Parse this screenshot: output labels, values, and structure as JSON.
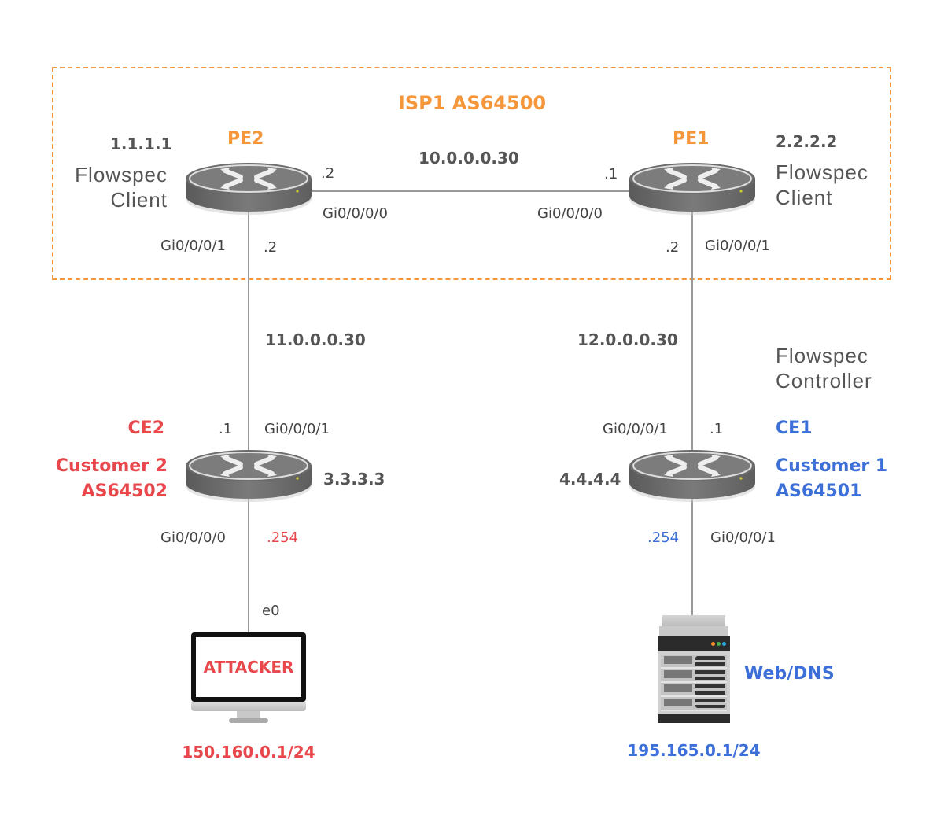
{
  "isp": {
    "title": "ISP1 AS64500"
  },
  "pe2": {
    "name": "PE2",
    "loopback": "1.1.1.1",
    "role_line1": "Flowspec",
    "role_line2": "Client",
    "east_ip": ".2",
    "east_if": "Gi0/0/0/0",
    "south_if": "Gi0/0/0/1",
    "south_ip": ".2"
  },
  "pe1": {
    "name": "PE1",
    "loopback": "2.2.2.2",
    "role_line1": "Flowspec",
    "role_line2": "Client",
    "west_ip": ".1",
    "west_if": "Gi0/0/0/0",
    "south_if": "Gi0/0/0/1",
    "south_ip": ".2"
  },
  "links": {
    "pe_pe": "10.0.0.0.30",
    "pe2_ce2": "11.0.0.0.30",
    "pe1_ce1": "12.0.0.0.30"
  },
  "ce2": {
    "name": "CE2",
    "customer": "Customer 2",
    "asn": "AS64502",
    "loopback": "3.3.3.3",
    "north_ip": ".1",
    "north_if": "Gi0/0/0/1",
    "south_if": "Gi0/0/0/0",
    "south_ip": ".254"
  },
  "ce1": {
    "name": "CE1",
    "customer": "Customer 1",
    "asn": "AS64501",
    "loopback": "4.4.4.4",
    "north_if": "Gi0/0/0/1",
    "north_ip": ".1",
    "south_ip": ".254",
    "south_if": "Gi0/0/0/1",
    "role_line1": "Flowspec",
    "role_line2": "Controller"
  },
  "attacker": {
    "screen_text": "ATTACKER",
    "if": "e0",
    "subnet": "150.160.0.1/24"
  },
  "server": {
    "name": "Web/DNS",
    "subnet": "195.165.0.1/24"
  },
  "colors": {
    "isp": "#f5963a",
    "customer2": "#e8474c",
    "customer1": "#3d6fd8",
    "text": "#555555"
  }
}
